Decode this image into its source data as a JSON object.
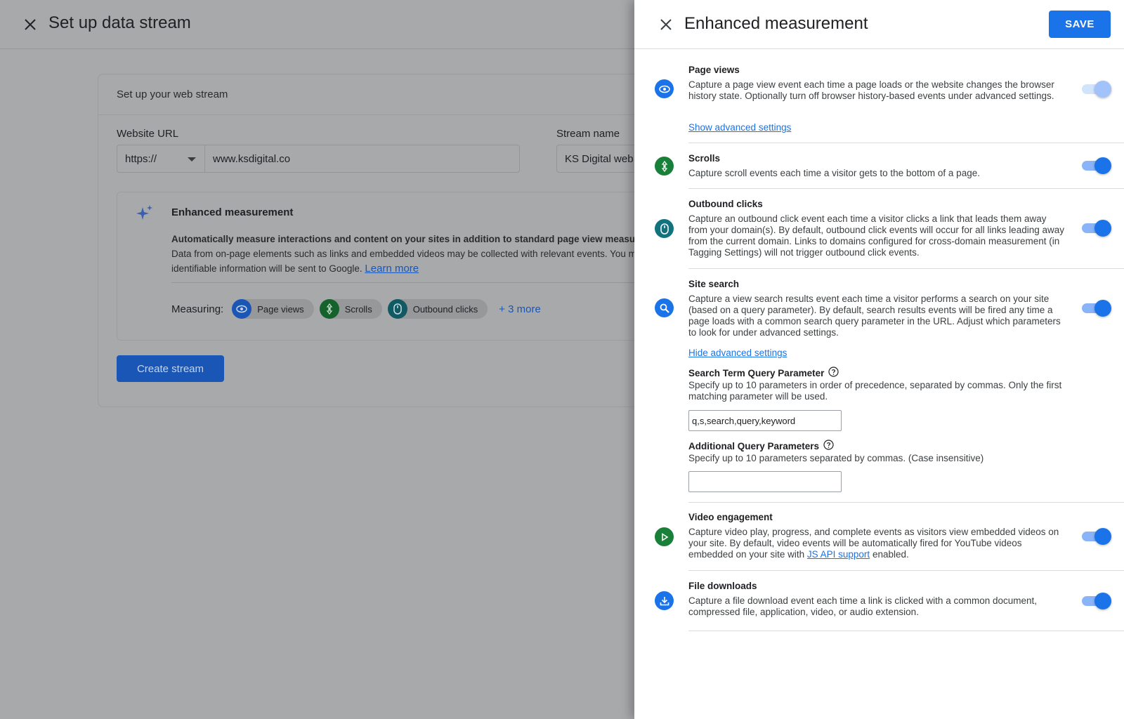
{
  "background": {
    "title": "Set up data stream",
    "card_title": "Set up your web stream",
    "website_url_label": "Website URL",
    "protocol": "https://",
    "url_value": "www.ksdigital.co",
    "stream_name_label": "Stream name",
    "stream_name_value": "KS Digital web",
    "enhanced": {
      "title": "Enhanced measurement",
      "desc_bold": "Automatically measure interactions and content on your sites in addition to standard page view measurement.",
      "desc_text": "Data from on-page elements such as links and embedded videos may be collected with relevant events. You m",
      "desc_text2": "identifiable information will be sent to Google.",
      "learn_more": "Learn more",
      "measuring_label": "Measuring:",
      "chips": [
        "Page views",
        "Scrolls",
        "Outbound clicks"
      ],
      "more": "+ 3 more"
    },
    "create_button": "Create stream"
  },
  "panel": {
    "title": "Enhanced measurement",
    "save": "SAVE",
    "items": {
      "page_views": {
        "title": "Page views",
        "desc": "Capture a page view event each time a page loads or the website changes the browser history state. Optionally turn off browser history-based events under advanced settings.",
        "link": "Show advanced settings",
        "icon": "eye-icon",
        "enabled": true
      },
      "scrolls": {
        "title": "Scrolls",
        "desc": "Capture scroll events each time a visitor gets to the bottom of a page.",
        "icon": "scroll-icon",
        "enabled": true
      },
      "outbound": {
        "title": "Outbound clicks",
        "desc": "Capture an outbound click event each time a visitor clicks a link that leads them away from your domain(s). By default, outbound click events will occur for all links leading away from the current domain. Links to domains configured for cross-domain measurement (in Tagging Settings) will not trigger outbound click events.",
        "icon": "mouse-icon",
        "enabled": true
      },
      "site_search": {
        "title": "Site search",
        "desc": "Capture a view search results event each time a visitor performs a search on your site (based on a query parameter). By default, search results events will be fired any time a page loads with a common search query parameter in the URL. Adjust which parameters to look for under advanced settings.",
        "link": "Hide advanced settings",
        "icon": "search-icon",
        "enabled": true,
        "term_label": "Search Term Query Parameter",
        "term_desc": "Specify up to 10 parameters in order of precedence, separated by commas. Only the first matching parameter will be used.",
        "term_value": "q,s,search,query,keyword",
        "additional_label": "Additional Query Parameters",
        "additional_desc": "Specify up to 10 parameters separated by commas. (Case insensitive)",
        "additional_value": ""
      },
      "video": {
        "title": "Video engagement",
        "desc_pre": "Capture video play, progress, and complete events as visitors view embedded videos on your site. By default, video events will be automatically fired for YouTube videos embedded on your site with",
        "desc_link": "JS API support",
        "desc_post": "enabled.",
        "icon": "play-icon",
        "enabled": true
      },
      "downloads": {
        "title": "File downloads",
        "desc": "Capture a file download event each time a link is clicked with a common document, compressed file, application, video, or audio extension.",
        "icon": "download-icon",
        "enabled": true
      }
    }
  },
  "colors": {
    "primary_blue": "#1a73e8",
    "green": "#188038",
    "teal": "#12737e",
    "overlay_gray": "#a8a9ab"
  }
}
